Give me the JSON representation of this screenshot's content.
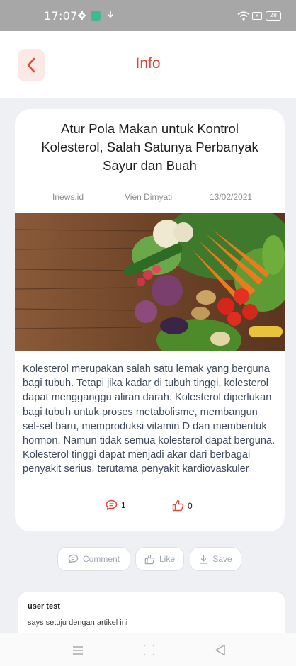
{
  "status_bar": {
    "time": "17:07",
    "battery": "28",
    "sim": "x"
  },
  "header": {
    "title": "Info"
  },
  "article": {
    "title": "Atur Pola Makan untuk Kontrol Kolesterol, Salah Satunya Perbanyak Sayur dan Buah",
    "source": "Inews.id",
    "author": "Vien Dimyati",
    "date": "13/02/2021",
    "body": "Kolesterol merupakan salah satu lemak yang berguna bagi tubuh. Tetapi jika kadar di tubuh tinggi, kolesterol dapat mengganggu aliran darah. Kolesterol diperlukan bagi tubuh untuk proses metabolisme, membangun sel-sel baru, memproduksi vitamin D dan membentuk hormon. Namun tidak semua kolesterol dapat berguna. Kolesterol tinggi dapat menjadi akar dari berbagai penyakit serius, terutama penyakit kardiovaskuler",
    "comment_count": "1",
    "like_count": "0"
  },
  "actions": {
    "comment_label": "Comment",
    "like_label": "Like",
    "save_label": "Save"
  },
  "comments": [
    {
      "user": "user test",
      "text": "says setuju dengan artikel ini"
    }
  ],
  "colors": {
    "accent": "#dd4a3c",
    "accent_soft": "#fbe9e6",
    "body_text": "#3e4a5c",
    "background": "#eef0f3"
  },
  "icons": {
    "back": "chevron-left-icon",
    "comment": "comment-icon",
    "like": "thumbs-up-icon",
    "save": "download-icon",
    "nav_menu": "menu-icon",
    "nav_home": "home-square-icon",
    "nav_back": "triangle-back-icon"
  }
}
